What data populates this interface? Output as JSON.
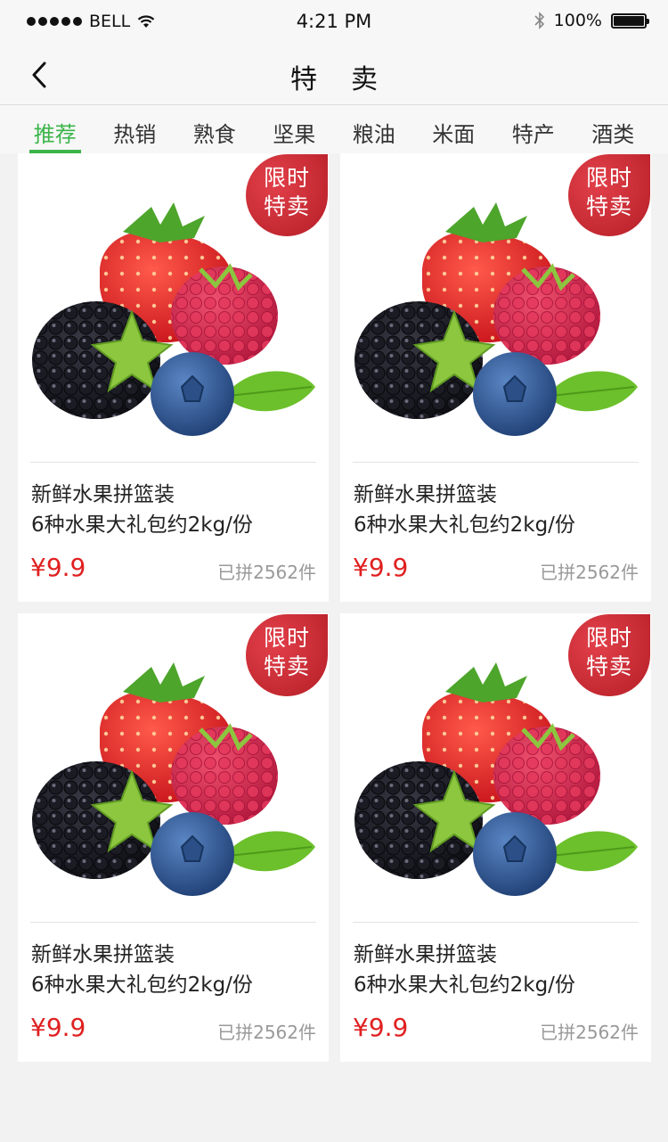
{
  "status": {
    "carrier": "BELL",
    "time": "4:21 PM",
    "battery": "100%"
  },
  "nav": {
    "title": "特卖"
  },
  "tabs": [
    "推荐",
    "热销",
    "熟食",
    "坚果",
    "粮油",
    "米面",
    "特产",
    "酒类"
  ],
  "active_tab": 0,
  "colors": {
    "accent_green": "#3bb54a",
    "price_red": "#e02020",
    "badge_red": "#c8232c"
  },
  "products": [
    {
      "badge_line1": "限时",
      "badge_line2": "特卖",
      "title_line1": "新鲜水果拼篮装",
      "title_line2": "6种水果大礼包约2kg/份",
      "price": "¥9.9",
      "sold": "已拼2562件"
    },
    {
      "badge_line1": "限时",
      "badge_line2": "特卖",
      "title_line1": "新鲜水果拼篮装",
      "title_line2": "6种水果大礼包约2kg/份",
      "price": "¥9.9",
      "sold": "已拼2562件"
    },
    {
      "badge_line1": "限时",
      "badge_line2": "特卖",
      "title_line1": "新鲜水果拼篮装",
      "title_line2": "6种水果大礼包约2kg/份",
      "price": "¥9.9",
      "sold": "已拼2562件"
    },
    {
      "badge_line1": "限时",
      "badge_line2": "特卖",
      "title_line1": "新鲜水果拼篮装",
      "title_line2": "6种水果大礼包约2kg/份",
      "price": "¥9.9",
      "sold": "已拼2562件"
    }
  ]
}
